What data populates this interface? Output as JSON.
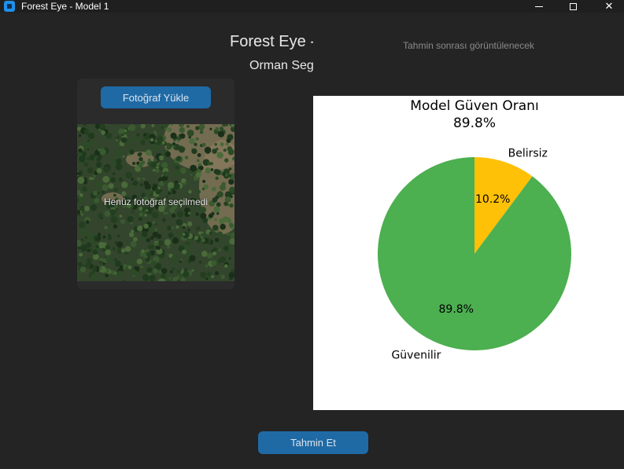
{
  "window": {
    "title": "Forest Eye - Model 1",
    "controls": {
      "minimize": "",
      "maximize": "",
      "close": "✕"
    }
  },
  "header": {
    "title": "Forest Eye -",
    "subtitle": "Orman Seg"
  },
  "photo_card": {
    "upload_button": "Fotoğraf Yükle",
    "empty_label": "Henüz fotoğraf seçilmedi"
  },
  "result": {
    "placeholder": "Tahmin sonrası görüntülenecek"
  },
  "actions": {
    "predict_button": "Tahmin Et"
  },
  "colors": {
    "accent": "#1f6aa5",
    "background": "#242424",
    "card": "#2b2b2b"
  },
  "chart_data": {
    "type": "pie",
    "title": "Model Güven Oranı",
    "subtitle": "89.8%",
    "slices": [
      {
        "label": "Belirsiz",
        "value": 10.2,
        "value_label": "10.2%",
        "color": "#ffc107"
      },
      {
        "label": "Güvenilir",
        "value": 89.8,
        "value_label": "89.8%",
        "color": "#4caf50"
      }
    ]
  }
}
